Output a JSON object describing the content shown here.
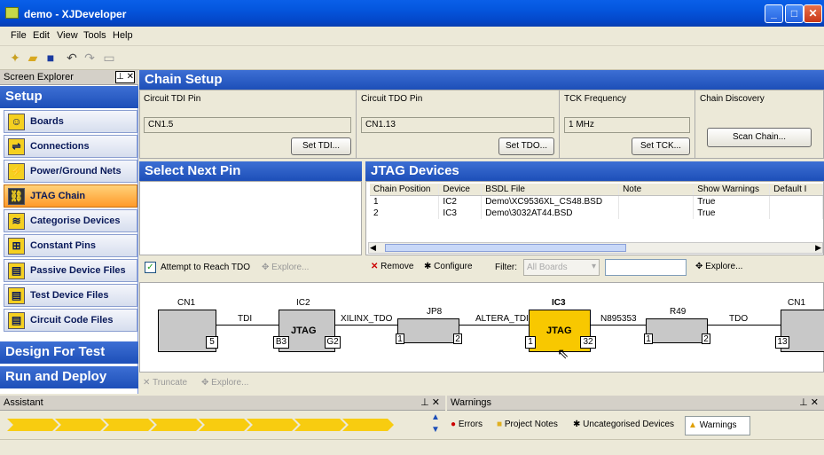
{
  "window": {
    "title": "demo - XJDeveloper"
  },
  "menu": [
    "File",
    "Edit",
    "View",
    "Tools",
    "Help"
  ],
  "explorer": {
    "title": "Screen Explorer",
    "sections": {
      "setup": "Setup",
      "design": "Design For Test",
      "run": "Run and Deploy"
    },
    "items": [
      {
        "label": "Boards",
        "icon": "boards-icon"
      },
      {
        "label": "Connections",
        "icon": "connections-icon"
      },
      {
        "label": "Power/Ground Nets",
        "icon": "power-ground-icon"
      },
      {
        "label": "JTAG Chain",
        "icon": "jtag-chain-icon",
        "active": true
      },
      {
        "label": "Categorise Devices",
        "icon": "categorise-icon"
      },
      {
        "label": "Constant Pins",
        "icon": "constant-pins-icon"
      },
      {
        "label": "Passive Device Files",
        "icon": "passive-files-icon"
      },
      {
        "label": "Test Device Files",
        "icon": "test-files-icon"
      },
      {
        "label": "Circuit Code Files",
        "icon": "code-files-icon"
      }
    ]
  },
  "chain_setup": {
    "title": "Chain Setup",
    "tdi": {
      "label": "Circuit TDI Pin",
      "value": "CN1.5",
      "button": "Set TDI..."
    },
    "tdo": {
      "label": "Circuit TDO Pin",
      "value": "CN1.13",
      "button": "Set TDO..."
    },
    "tck": {
      "label": "TCK Frequency",
      "value": "1 MHz",
      "button": "Set TCK..."
    },
    "discovery": {
      "label": "Chain Discovery",
      "button": "Scan Chain..."
    }
  },
  "select_next_pin": {
    "title": "Select Next Pin",
    "checkbox": "Attempt to Reach TDO",
    "explore": "Explore..."
  },
  "jtag_devices": {
    "title": "JTAG Devices",
    "columns": [
      "Chain Position",
      "Device",
      "BSDL File",
      "Note",
      "Show Warnings",
      "Default I"
    ],
    "rows": [
      [
        "1",
        "IC2",
        "Demo\\XC9536XL_CS48.BSD",
        "",
        "True",
        ""
      ],
      [
        "2",
        "IC3",
        "Demo\\3032AT44.BSD",
        "",
        "True",
        ""
      ]
    ],
    "remove": "Remove",
    "configure": "Configure",
    "filter_label": "Filter:",
    "filter_value": "All Boards",
    "explore": "Explore..."
  },
  "diagram": {
    "components": {
      "cn1": "CN1",
      "ic2": "IC2",
      "jp8": "JP8",
      "ic3": "IC3",
      "r49": "R49",
      "cn1b": "CN1"
    },
    "chips": {
      "ic2": "JTAG",
      "ic3": "JTAG"
    },
    "pins": {
      "cn1": "5",
      "ic2_in": "B3",
      "ic2_out": "G2",
      "jp8_in": "1",
      "jp8_out": "2",
      "ic3_in": "1",
      "ic3_out": "32",
      "r49_in": "1",
      "r49_out": "2",
      "cn1b": "13"
    },
    "nets": {
      "tdi": "TDI",
      "xilinx": "XILINX_TDO",
      "altera": "ALTERA_TDI",
      "n895": "N895353",
      "tdo": "TDO"
    },
    "truncate": "Truncate",
    "explore": "Explore..."
  },
  "assistant": {
    "title": "Assistant"
  },
  "warnings": {
    "title": "Warnings",
    "tabs": [
      "Errors",
      "Project Notes",
      "Uncategorised Devices",
      "Warnings"
    ]
  }
}
